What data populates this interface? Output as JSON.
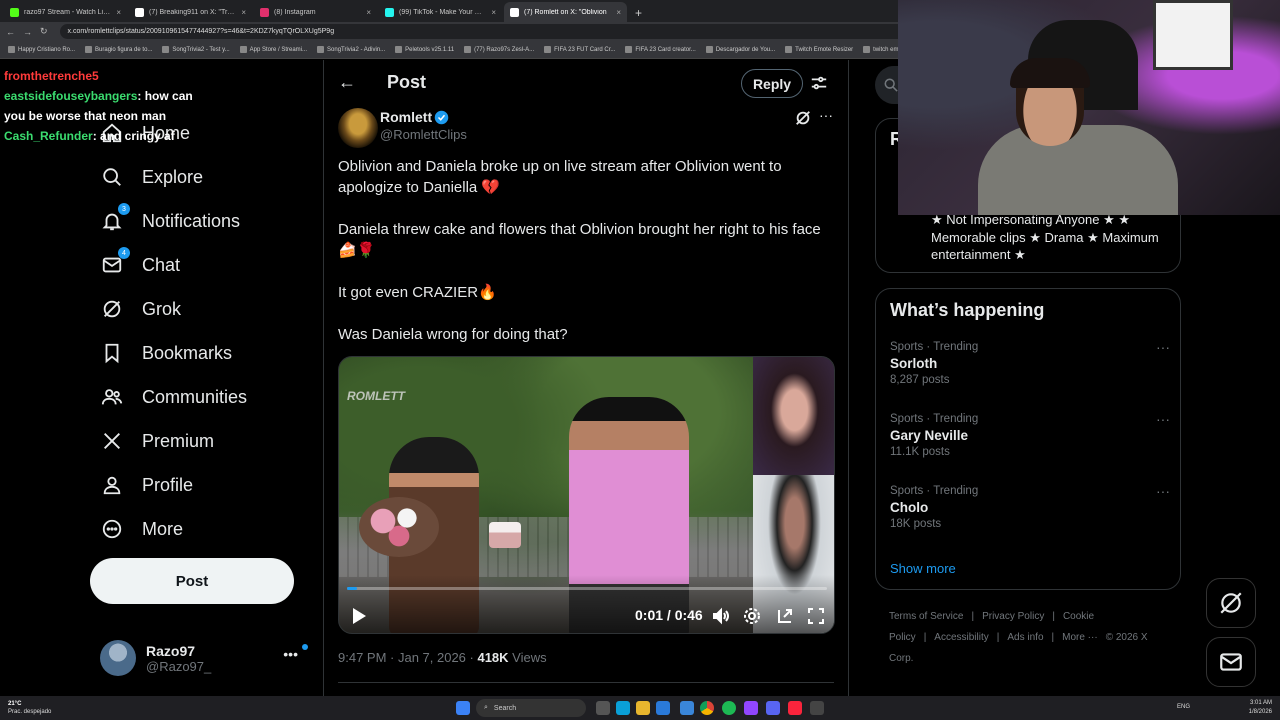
{
  "browser": {
    "tabs": [
      {
        "label": "razo97 Stream - Watch Live on",
        "color": "#53fc18",
        "active": false
      },
      {
        "label": "(7) Breaking911 on X: \"Trum",
        "color": "#ffffff",
        "active": false
      },
      {
        "label": "(8) Instagram",
        "color": "#e1306c",
        "active": false
      },
      {
        "label": "(99) TikTok - Make Your Day",
        "color": "#25f4ee",
        "active": false
      },
      {
        "label": "(7) Romlett on X: \"Oblivion",
        "color": "#ffffff",
        "active": true
      }
    ],
    "url": "x.com/romlettclips/status/2009109615477444927?s=46&t=2KDZ7kyqTQrOLXUg5P9g",
    "bookmarks": [
      "Happy Cristiano Ro...",
      "Buragio figura de to...",
      "SongTrivia2 - Test y...",
      "App Store / Streami...",
      "SongTrivia2 - Adivin...",
      "Peletools v25.1.11",
      "(77) Razo97s Zesl-A...",
      "FIFA 23 FUT Card Cr...",
      "FIFA 23 Card creator...",
      "Descargador de You...",
      "Twitch Emote Resizer",
      "twitch em"
    ]
  },
  "chat": [
    {
      "user": "fromthetrenche5",
      "text": "",
      "color": "red"
    },
    {
      "user": "eastsidefouseybangers",
      "text": ": how can you be worse that neon man",
      "color": "green"
    },
    {
      "user": "Cash_Refunder",
      "text": ": and cringy af",
      "color": "green"
    }
  ],
  "nav": {
    "items": [
      {
        "label": "Home",
        "icon": "home-icon",
        "badge": ""
      },
      {
        "label": "Explore",
        "icon": "search-icon",
        "badge": ""
      },
      {
        "label": "Notifications",
        "icon": "bell-icon",
        "badge": "3"
      },
      {
        "label": "Chat",
        "icon": "mail-icon",
        "badge": "4"
      },
      {
        "label": "Grok",
        "icon": "grok-icon",
        "badge": ""
      },
      {
        "label": "Bookmarks",
        "icon": "bookmark-icon",
        "badge": ""
      },
      {
        "label": "Communities",
        "icon": "people-icon",
        "badge": ""
      },
      {
        "label": "Premium",
        "icon": "x-logo-icon",
        "badge": ""
      },
      {
        "label": "Profile",
        "icon": "person-icon",
        "badge": ""
      },
      {
        "label": "More",
        "icon": "more-circle-icon",
        "badge": ""
      }
    ],
    "post_label": "Post",
    "account": {
      "name": "Razo97",
      "handle": "@Razo97_"
    }
  },
  "main": {
    "header_title": "Post",
    "reply_label": "Reply",
    "author": {
      "name": "Romlett",
      "handle": "@RomlettClips"
    },
    "paragraphs": [
      "Oblivion and Daniela broke up on live stream after Oblivion went to apologize to Daniella 💔",
      "Daniela threw cake and flowers that Oblivion brought her right to his face 🍰🌹",
      "It got even CRAZIER🔥",
      "Was Daniela wrong for doing that?"
    ],
    "video": {
      "watermark": "ROMLETT",
      "time": "0:01 / 0:46",
      "progress": 0.02
    },
    "meta": {
      "time": "9:47 PM · Jan 7, 2026 · ",
      "views_count": "418K",
      "views_label": " Views"
    }
  },
  "right": {
    "bio_letter": "R",
    "bio": "★ Not Impersonating Anyone ★ ★ Memorable clips ★ Drama ★ Maximum entertainment ★",
    "happening_title": "What’s happening",
    "trends": [
      {
        "meta": "Sports · Trending",
        "name": "Sorloth",
        "count": "8,287 posts"
      },
      {
        "meta": "Sports · Trending",
        "name": "Gary Neville",
        "count": "11.1K posts"
      },
      {
        "meta": "Sports · Trending",
        "name": "Cholo",
        "count": "18K posts"
      }
    ],
    "show_more": "Show more",
    "footer": [
      "Terms of Service",
      "|",
      "Privacy Policy",
      "|",
      "Cookie Policy",
      "|",
      "Accessibility",
      "|",
      "Ads info",
      "|",
      "More ···",
      "© 2026 X Corp."
    ]
  },
  "taskbar": {
    "weather_temp": "21°C",
    "weather_desc": "Prac. despejado",
    "search_label": "Search",
    "lang": "ENG",
    "time": "3:01 AM",
    "date": "1/8/2026"
  }
}
